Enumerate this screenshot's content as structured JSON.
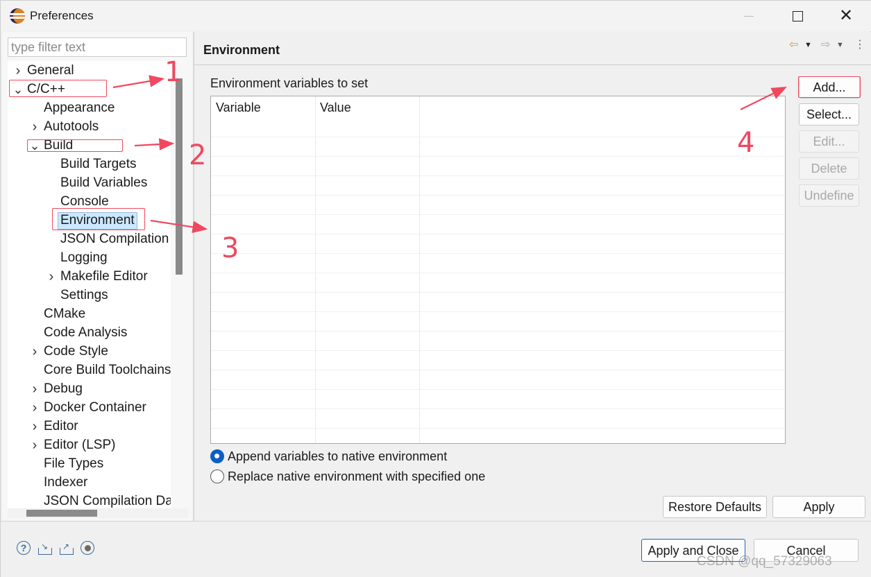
{
  "window": {
    "title": "Preferences"
  },
  "filter": {
    "placeholder": "type filter text"
  },
  "tree": {
    "items": [
      {
        "label": "General",
        "expander": ">"
      },
      {
        "label": "C/C++",
        "expander": "v"
      },
      {
        "label": "Appearance",
        "expander": ""
      },
      {
        "label": "Autotools",
        "expander": ">"
      },
      {
        "label": "Build",
        "expander": "v"
      },
      {
        "label": "Build Targets",
        "expander": ""
      },
      {
        "label": "Build Variables",
        "expander": ""
      },
      {
        "label": "Console",
        "expander": ""
      },
      {
        "label": "Environment",
        "expander": "",
        "selected": true
      },
      {
        "label": "JSON Compilation",
        "expander": ""
      },
      {
        "label": "Logging",
        "expander": ""
      },
      {
        "label": "Makefile Editor",
        "expander": ">"
      },
      {
        "label": "Settings",
        "expander": ""
      },
      {
        "label": "CMake",
        "expander": ""
      },
      {
        "label": "Code Analysis",
        "expander": ""
      },
      {
        "label": "Code Style",
        "expander": ">"
      },
      {
        "label": "Core Build Toolchains",
        "expander": ""
      },
      {
        "label": "Debug",
        "expander": ">"
      },
      {
        "label": "Docker Container",
        "expander": ">"
      },
      {
        "label": "Editor",
        "expander": ">"
      },
      {
        "label": "Editor (LSP)",
        "expander": ">"
      },
      {
        "label": "File Types",
        "expander": ""
      },
      {
        "label": "Indexer",
        "expander": ""
      },
      {
        "label": "JSON Compilation Da",
        "expander": ""
      }
    ]
  },
  "page": {
    "title": "Environment",
    "table_label": "Environment variables to set",
    "columns": [
      "Variable",
      "Value"
    ],
    "buttons": {
      "add": "Add...",
      "select": "Select...",
      "edit": "Edit...",
      "delete": "Delete",
      "undefine": "Undefine"
    },
    "radio_append": "Append variables to native environment",
    "radio_replace": "Replace native environment with specified one",
    "restore_defaults": "Restore Defaults",
    "apply": "Apply"
  },
  "footer": {
    "apply_and_close": "Apply and Close",
    "cancel": "Cancel",
    "watermark": "CSDN @qq_57329063",
    "icons": [
      "help-icon",
      "import-icon",
      "export-icon",
      "record-icon"
    ]
  },
  "annotations": {
    "numbers": [
      "1",
      "2",
      "3",
      "4"
    ],
    "color": "#f0485f"
  },
  "colors": {
    "selection": "#cce8ff",
    "radio_checked": "#0c5fc5",
    "primary_border": "#1f64b5"
  }
}
